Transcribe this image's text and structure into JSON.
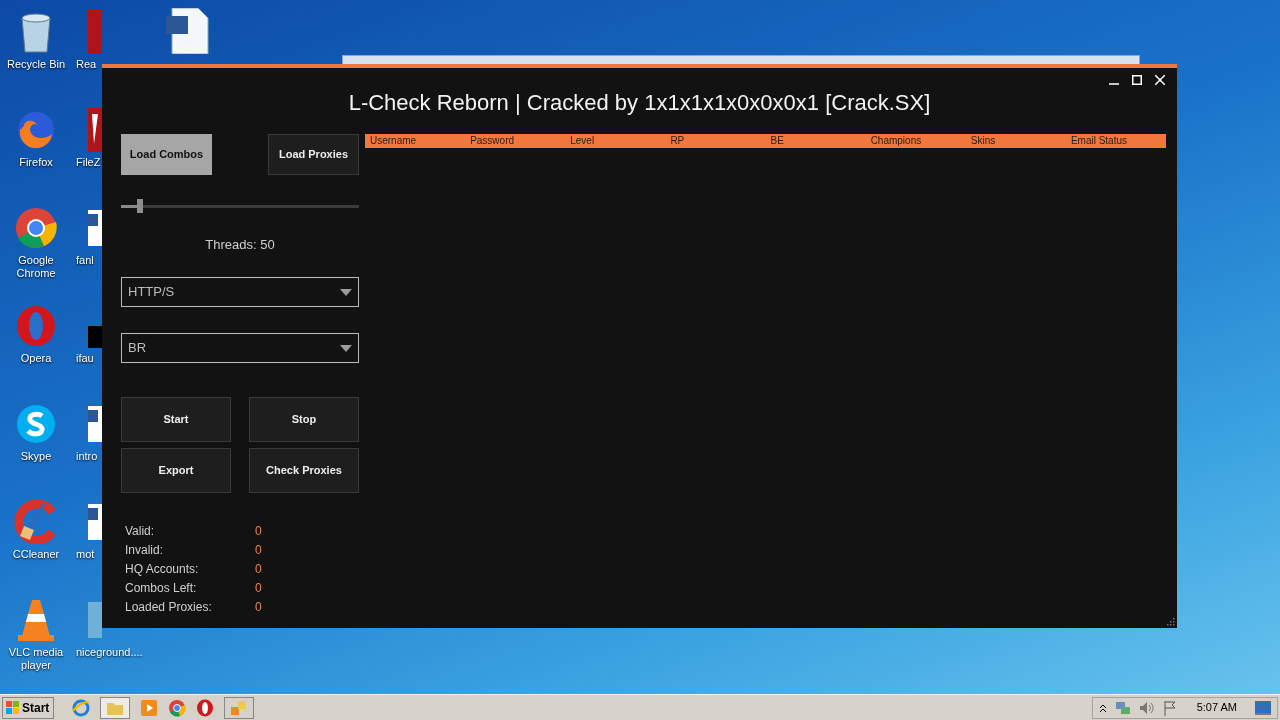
{
  "desktop": {
    "icons": [
      {
        "label": "Recycle Bin"
      },
      {
        "label": "Firefox"
      },
      {
        "label": "Google Chrome"
      },
      {
        "label": "Opera"
      },
      {
        "label": "Skype"
      },
      {
        "label": "CCleaner"
      },
      {
        "label": "VLC media player"
      }
    ],
    "icons_column_2": [
      {
        "label": "Rea"
      },
      {
        "label": "FileZ"
      },
      {
        "label": "fanl"
      },
      {
        "label": "ifau"
      },
      {
        "label": "intro"
      },
      {
        "label": "mot"
      },
      {
        "label": "niceground...."
      }
    ]
  },
  "app": {
    "title": "L-Check Reborn | Cracked by 1x1x1x1x0x0x0x1 [Crack.SX]",
    "load_buttons": [
      {
        "label": "Load Combos",
        "highlighted": true
      },
      {
        "label": "Load Proxies",
        "highlighted": false
      }
    ],
    "threads_slider": {
      "level": 0.08
    },
    "threads_label": "Threads: 50",
    "dropdowns": [
      {
        "value": "HTTP/S"
      },
      {
        "value": "BR"
      }
    ],
    "action_buttons": [
      "Start",
      "Stop",
      "Export",
      "Check Proxies"
    ],
    "stats": [
      {
        "label": "Valid:",
        "value": "0"
      },
      {
        "label": "Invalid:",
        "value": "0"
      },
      {
        "label": "HQ Accounts:",
        "value": "0"
      },
      {
        "label": "Combos Left:",
        "value": "0"
      },
      {
        "label": "Loaded Proxies:",
        "value": "0"
      }
    ],
    "table": {
      "columns": [
        "Username",
        "Password",
        "Level",
        "RP",
        "BE",
        "Champions",
        "Skins",
        "Email Status"
      ]
    }
  },
  "taskbar": {
    "start": "Start",
    "clock": "5:07 AM"
  }
}
